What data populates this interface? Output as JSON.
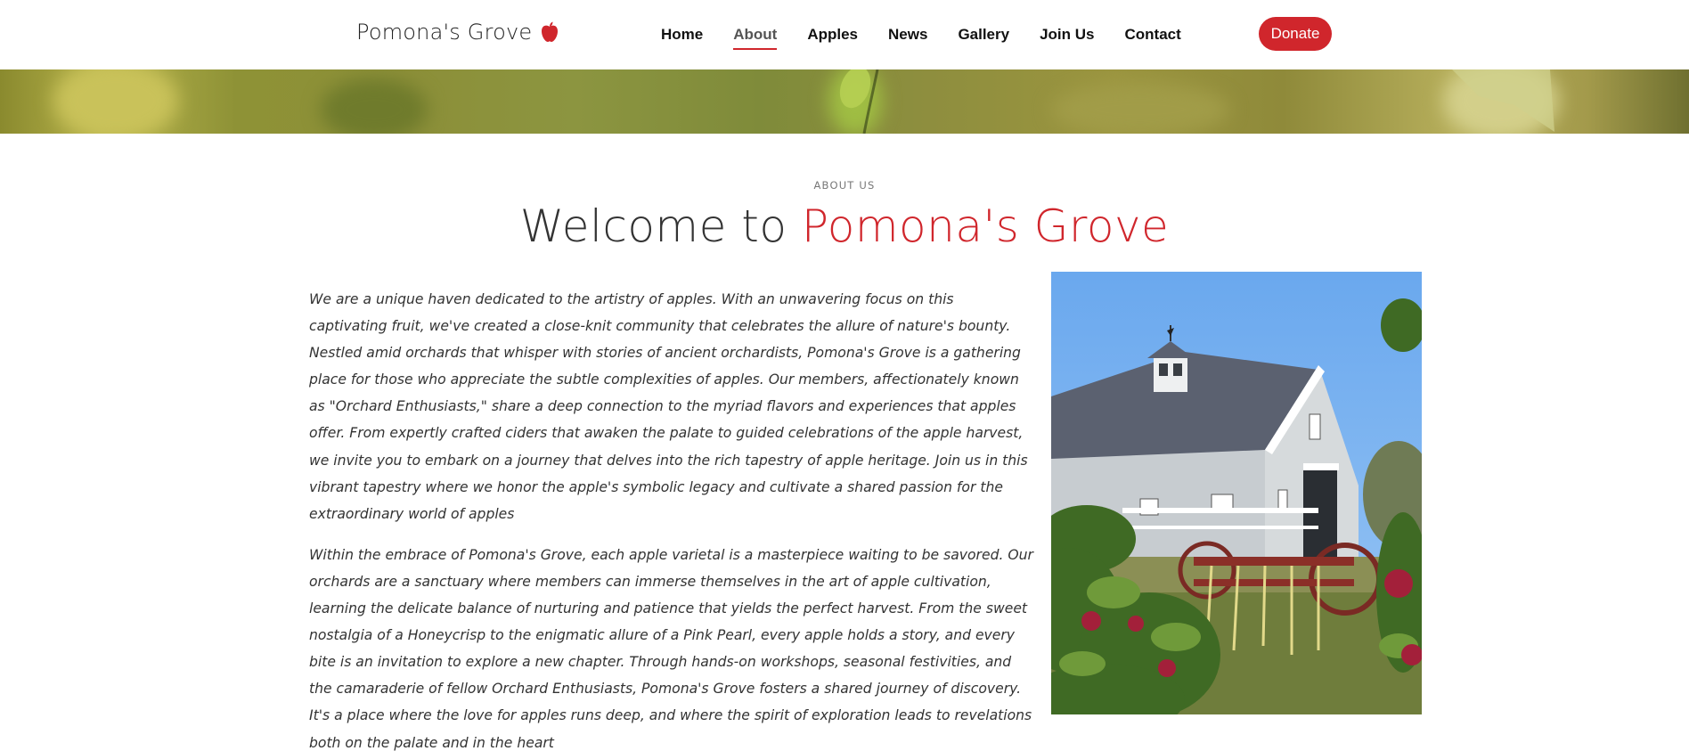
{
  "header": {
    "logo_text": "Pomona's Grove",
    "nav": [
      {
        "label": "Home",
        "active": false
      },
      {
        "label": "About",
        "active": true
      },
      {
        "label": "Apples",
        "active": false
      },
      {
        "label": "News",
        "active": false
      },
      {
        "label": "Gallery",
        "active": false
      },
      {
        "label": "Join Us",
        "active": false
      },
      {
        "label": "Contact",
        "active": false
      }
    ],
    "donate_label": "Donate"
  },
  "section": {
    "eyebrow": "ABOUT US",
    "title_prefix": "Welcome to ",
    "title_accent": "Pomona's Grove",
    "paragraphs": [
      "We are a unique haven dedicated to the artistry of apples. With an unwavering focus on this captivating fruit, we've created a close-knit community that celebrates the allure of nature's bounty. Nestled amid orchards that whisper with stories of ancient orchardists, Pomona's Grove is a gathering place for those who appreciate the subtle complexities of apples. Our members, affectionately known as \"Orchard Enthusiasts,\" share a deep connection to the myriad flavors and experiences that apples offer. From expertly crafted ciders that awaken the palate to guided celebrations of the apple harvest, we invite you to embark on a journey that delves into the rich tapestry of apple heritage. Join us in this vibrant tapestry where we honor the apple's symbolic legacy and cultivate a shared passion for the extraordinary world of apples",
      "Within the embrace of Pomona's Grove, each apple varietal is a masterpiece waiting to be savored. Our orchards are a sanctuary where members can immerse themselves in the art of apple cultivation, learning the delicate balance of nurturing and patience that yields the perfect harvest. From the sweet nostalgia of a Honeycrisp to the enigmatic allure of a Pink Pearl, every apple holds a story, and every bite is an invitation to explore a new chapter. Through hands-on workshops, seasonal festivities, and the camaraderie of fellow Orchard Enthusiasts, Pomona's Grove fosters a shared journey of discovery. It's a place where the love for apples runs deep, and where the spirit of exploration leads to revelations both on the palate and in the heart"
    ]
  },
  "icons": {
    "logo": "apple-icon"
  },
  "colors": {
    "accent": "#d0262c",
    "text": "#333333"
  }
}
